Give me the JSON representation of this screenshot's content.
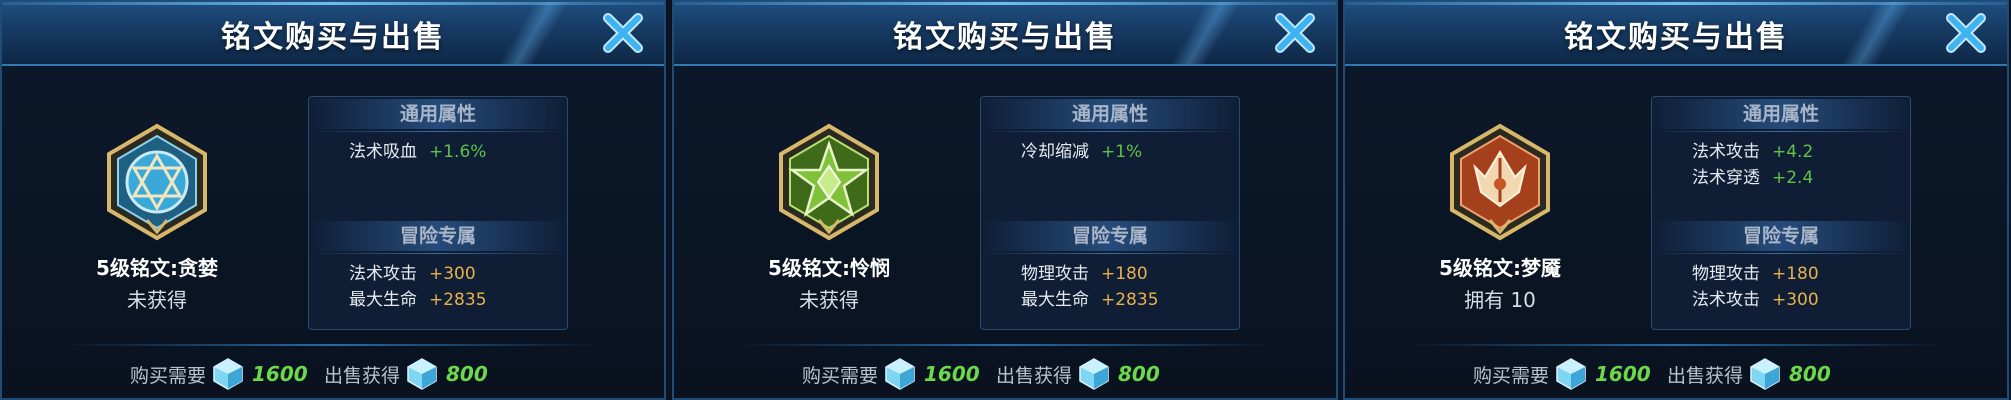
{
  "panels": [
    {
      "title": "铭文购买与出售",
      "rune_name": "5级铭文:贪婪",
      "status": "未获得",
      "general_header": "通用属性",
      "general_attrs": [
        {
          "label": "法术吸血",
          "value": "+1.6%"
        }
      ],
      "adventure_header": "冒险专属",
      "adventure_attrs": [
        {
          "label": "法术攻击",
          "value": "+300"
        },
        {
          "label": "最大生命",
          "value": "+2835"
        }
      ],
      "buy_label": "购买需要",
      "buy_value": "1600",
      "sell_label": "出售获得",
      "sell_value": "800",
      "badge_icon": "blue-hexagram-rune-icon",
      "badge_color": "#3aa9d8"
    },
    {
      "title": "铭文购买与出售",
      "rune_name": "5级铭文:怜悯",
      "status": "未获得",
      "general_header": "通用属性",
      "general_attrs": [
        {
          "label": "冷却缩减",
          "value": "+1%"
        }
      ],
      "adventure_header": "冒险专属",
      "adventure_attrs": [
        {
          "label": "物理攻击",
          "value": "+180"
        },
        {
          "label": "最大生命",
          "value": "+2835"
        }
      ],
      "buy_label": "购买需要",
      "buy_value": "1600",
      "sell_label": "出售获得",
      "sell_value": "800",
      "badge_icon": "green-star-rune-icon",
      "badge_color": "#7fc23a"
    },
    {
      "title": "铭文购买与出售",
      "rune_name": "5级铭文:梦魇",
      "status": "拥有 10",
      "general_header": "通用属性",
      "general_attrs": [
        {
          "label": "法术攻击",
          "value": "+4.2"
        },
        {
          "label": "法术穿透",
          "value": "+2.4"
        }
      ],
      "adventure_header": "冒险专属",
      "adventure_attrs": [
        {
          "label": "物理攻击",
          "value": "+180"
        },
        {
          "label": "法术攻击",
          "value": "+300"
        }
      ],
      "buy_label": "购买需要",
      "buy_value": "1600",
      "sell_label": "出售获得",
      "sell_value": "800",
      "badge_icon": "red-wing-rune-icon",
      "badge_color": "#c8542a"
    }
  ],
  "icons": {
    "close": "close-x-icon",
    "currency": "crystal-gem-icon"
  },
  "colors": {
    "general_value": "#5ec24a",
    "adventure_value": "#e8b24a",
    "price": "#6bd94a"
  }
}
